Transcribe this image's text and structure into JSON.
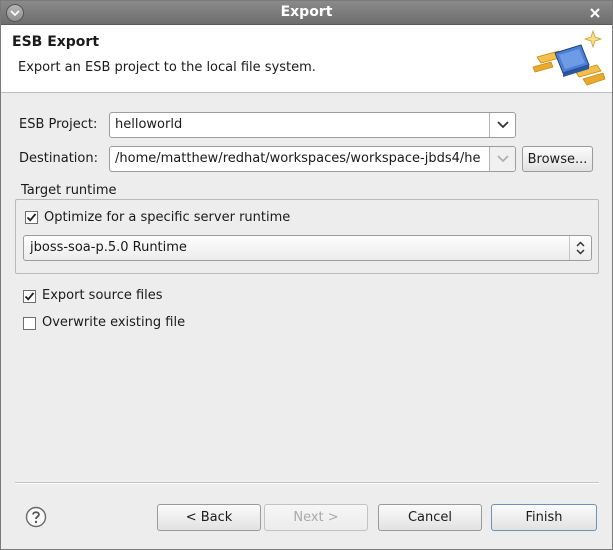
{
  "window": {
    "title": "Export"
  },
  "header": {
    "title": "ESB Export",
    "description": "Export an ESB project to the local file system."
  },
  "form": {
    "project_label": "ESB Project:",
    "project_value": "helloworld",
    "destination_label": "Destination:",
    "destination_value": "/home/matthew/redhat/workspaces/workspace-jbds4/he",
    "browse_label": "Browse..."
  },
  "target_runtime": {
    "group_label": "Target runtime",
    "optimize_label": "Optimize for a specific server runtime",
    "optimize_checked": true,
    "runtime_value": "jboss-soa-p.5.0 Runtime"
  },
  "options": {
    "export_source_label": "Export source files",
    "export_source_checked": true,
    "overwrite_label": "Overwrite existing file",
    "overwrite_checked": false
  },
  "buttons": {
    "back": "< Back",
    "next": "Next >",
    "cancel": "Cancel",
    "finish": "Finish"
  },
  "icons": {
    "help": "help-icon",
    "wizard": "esb-export-wizard-icon",
    "close": "close-icon",
    "menu": "window-menu-icon"
  }
}
